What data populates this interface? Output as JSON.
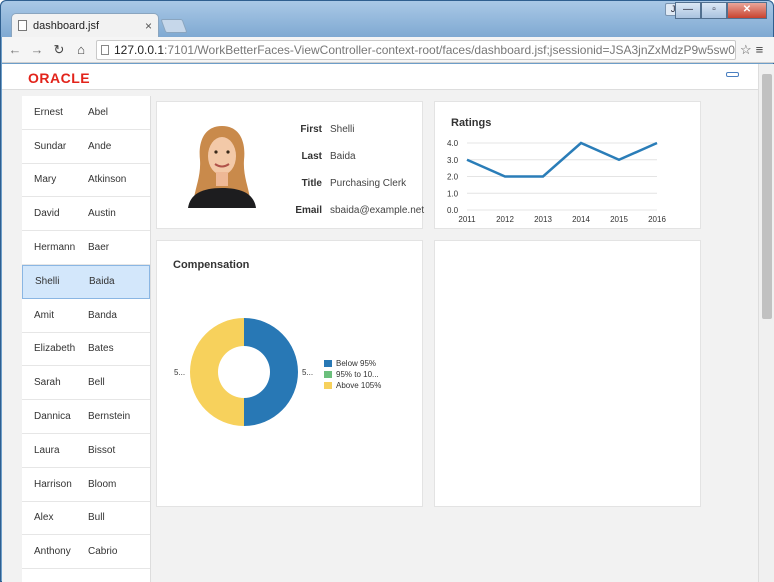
{
  "browser": {
    "tab_title": "dashboard.jsf",
    "tab_close": "×",
    "user_badge": "Jeff",
    "url_host": "127.0.0.1",
    "url_path": ":7101/WorkBetterFaces-ViewController-context-root/faces/dashboard.jsf;jsessionid=JSA3jnZxMdzP9w5sw0",
    "window_buttons": [
      "—",
      "▫",
      "✕"
    ]
  },
  "brand": {
    "logo": "ORACLE"
  },
  "employees": [
    {
      "first": "Ernest",
      "last": "Abel"
    },
    {
      "first": "Sundar",
      "last": "Ande"
    },
    {
      "first": "Mary",
      "last": "Atkinson"
    },
    {
      "first": "David",
      "last": "Austin"
    },
    {
      "first": "Hermann",
      "last": "Baer"
    },
    {
      "first": "Shelli",
      "last": "Baida"
    },
    {
      "first": "Amit",
      "last": "Banda"
    },
    {
      "first": "Elizabeth",
      "last": "Bates"
    },
    {
      "first": "Sarah",
      "last": "Bell"
    },
    {
      "first": "Dannica",
      "last": "Bernstein"
    },
    {
      "first": "Laura",
      "last": "Bissot"
    },
    {
      "first": "Harrison",
      "last": "Bloom"
    },
    {
      "first": "Alex",
      "last": "Bull"
    },
    {
      "first": "Anthony",
      "last": "Cabrio"
    }
  ],
  "selected_index": 5,
  "details": {
    "labels": {
      "first": "First",
      "last": "Last",
      "title": "Title",
      "email": "Email"
    },
    "first": "Shelli",
    "last": "Baida",
    "title": "Purchasing Clerk",
    "email": "sbaida@example.net"
  },
  "ratings": {
    "title": "Ratings"
  },
  "compensation": {
    "title": "Compensation",
    "left_label": "5...",
    "right_label": "5..."
  },
  "chart_data": [
    {
      "type": "line",
      "title": "Ratings",
      "x": [
        "2011",
        "2012",
        "2013",
        "2014",
        "2015",
        "2016"
      ],
      "series": [
        {
          "values": [
            3.0,
            2.0,
            2.0,
            4.0,
            3.0,
            4.0
          ]
        }
      ],
      "y_ticks": [
        "4.0",
        "3.0",
        "2.0",
        "1.0",
        "0.0"
      ],
      "ylim": [
        0,
        4
      ],
      "grid": true,
      "color": "#2a7db8"
    },
    {
      "type": "pie",
      "title": "Compensation",
      "donut": true,
      "categories": [
        "Below 95%",
        "95% to 10...",
        "Above 105%"
      ],
      "values": [
        50,
        0,
        50
      ],
      "colors": [
        "#2878b5",
        "#6bbf7c",
        "#f7d15c"
      ]
    }
  ]
}
